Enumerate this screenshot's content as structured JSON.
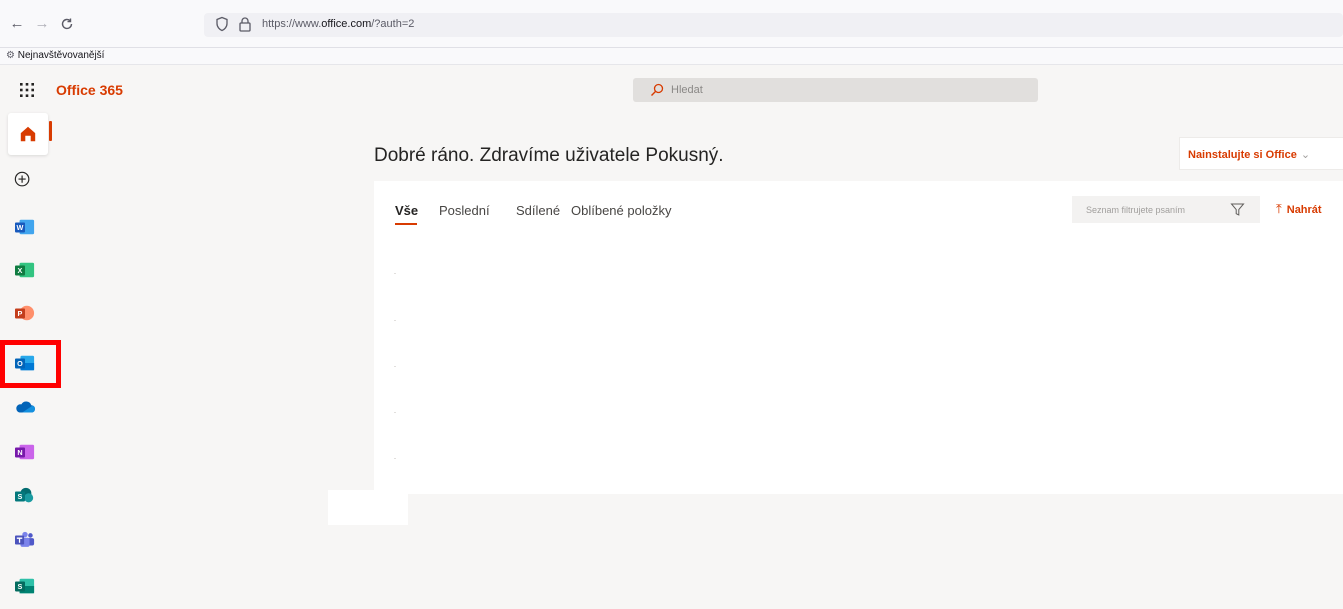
{
  "browser": {
    "url_prefix": "https://www.",
    "url_domain": "office.com",
    "url_suffix": "/?auth=2",
    "bookmark_label": "Nejnavštěvovanější"
  },
  "header": {
    "brand": "Office 365",
    "search_placeholder": "Hledat"
  },
  "rail": {
    "items": [
      {
        "name": "home",
        "badge": ""
      },
      {
        "name": "create",
        "badge": ""
      },
      {
        "name": "word",
        "badge": "W",
        "color": "#2b579a"
      },
      {
        "name": "excel",
        "badge": "X",
        "color": "#217346"
      },
      {
        "name": "powerpoint",
        "badge": "P",
        "color": "#d24726"
      },
      {
        "name": "outlook",
        "badge": "O",
        "color": "#0078d4"
      },
      {
        "name": "onedrive",
        "badge": "",
        "color": "#0364b8"
      },
      {
        "name": "onenote",
        "badge": "N",
        "color": "#7719aa"
      },
      {
        "name": "sharepoint",
        "badge": "S",
        "color": "#038387"
      },
      {
        "name": "teams",
        "badge": "",
        "color": "#5059c9"
      },
      {
        "name": "sway",
        "badge": "S",
        "color": "#008272"
      }
    ]
  },
  "main": {
    "greeting": "Dobré ráno. Zdravíme uživatele Pokusný.",
    "install_label": "Nainstalujte si Office",
    "tabs": {
      "all": "Vše",
      "recent": "Poslední",
      "shared": "Sdílené",
      "favorites": "Oblíbené položky"
    },
    "filter_placeholder": "Seznam filtrujete psaním",
    "upload_label": "Nahrát"
  },
  "colors": {
    "accent": "#d83b01",
    "highlight": "#ff0000"
  }
}
